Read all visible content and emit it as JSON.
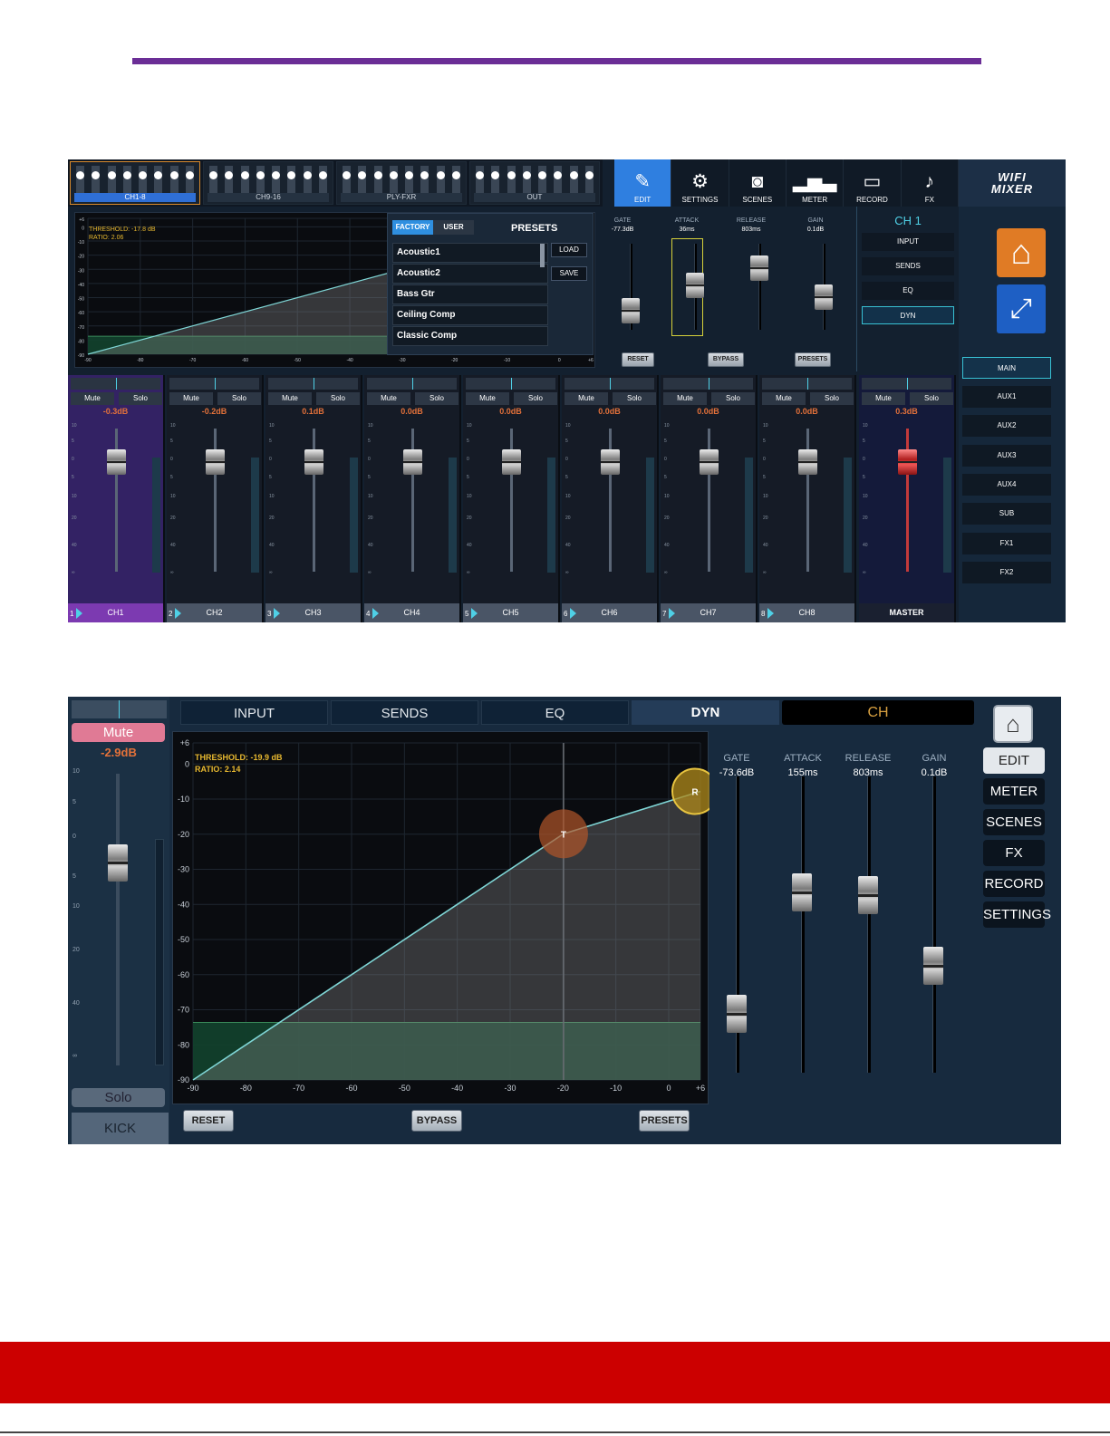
{
  "screen1": {
    "banks": [
      {
        "label": "CH1-8"
      },
      {
        "label": "CH9-16"
      },
      {
        "label": "PLY-FXR"
      },
      {
        "label": "OUT"
      }
    ],
    "top_icons": [
      {
        "label": "EDIT",
        "icon": "edit-icon"
      },
      {
        "label": "SETTINGS",
        "icon": "gear-icon"
      },
      {
        "label": "SCENES",
        "icon": "camera-icon"
      },
      {
        "label": "METER",
        "icon": "bar-chart-icon"
      },
      {
        "label": "RECORD",
        "icon": "cassette-icon"
      },
      {
        "label": "FX",
        "icon": "guitar-icon"
      }
    ],
    "logo": {
      "line1": "WIFI",
      "line2": "MIXER"
    },
    "graph": {
      "threshold": "THRESHOLD: -17.8 dB",
      "ratio": "RATIO: 2.06",
      "y_ticks": [
        "+6",
        "0",
        "-10",
        "-20",
        "-30",
        "-40",
        "-50",
        "-60",
        "-70",
        "-80",
        "-90"
      ],
      "x_ticks": [
        "-90",
        "-80",
        "-70",
        "-60",
        "-50",
        "-40",
        "-30",
        "-20",
        "-10",
        "0",
        "+6"
      ]
    },
    "presets": {
      "tab_factory": "FACTORY",
      "tab_user": "USER",
      "title": "PRESETS",
      "items": [
        "Acoustic1",
        "Acoustic2",
        "Bass Gtr",
        "Ceiling Comp",
        "Classic Comp"
      ],
      "load": "LOAD",
      "save": "SAVE"
    },
    "dyn": [
      {
        "label": "GATE",
        "value": "-77.3dB",
        "level": 0.22
      },
      {
        "label": "ATTACK",
        "value": "36ms",
        "level": 0.52
      },
      {
        "label": "RELEASE",
        "value": "803ms",
        "level": 0.72
      },
      {
        "label": "GAIN",
        "value": "0.1dB",
        "level": 0.38
      }
    ],
    "dyn_buttons": {
      "reset": "RESET",
      "bypass": "BYPASS",
      "presets": "PRESETS"
    },
    "channel_panel": {
      "title": "CH 1",
      "items": [
        "INPUT",
        "SENDS",
        "EQ",
        "DYN"
      ],
      "selected": "DYN"
    },
    "buses": [
      "MAIN",
      "AUX1",
      "AUX2",
      "AUX3",
      "AUX4",
      "SUB",
      "FX1",
      "FX2"
    ],
    "selected_bus": "MAIN",
    "strips": [
      {
        "num": "1",
        "name": "CH1",
        "db": "-0.3dB"
      },
      {
        "num": "2",
        "name": "CH2",
        "db": "-0.2dB"
      },
      {
        "num": "3",
        "name": "CH3",
        "db": "0.1dB"
      },
      {
        "num": "4",
        "name": "CH4",
        "db": "0.0dB"
      },
      {
        "num": "5",
        "name": "CH5",
        "db": "0.0dB"
      },
      {
        "num": "6",
        "name": "CH6",
        "db": "0.0dB"
      },
      {
        "num": "7",
        "name": "CH7",
        "db": "0.0dB"
      },
      {
        "num": "8",
        "name": "CH8",
        "db": "0.0dB"
      }
    ],
    "master": {
      "name": "MASTER",
      "db": "0.3dB"
    },
    "mute_label": "Mute",
    "solo_label": "Solo",
    "fader_scale": [
      "10",
      "5",
      "0",
      "5",
      "10",
      "20",
      "40",
      "∞"
    ]
  },
  "screen2": {
    "left_strip": {
      "mute": "Mute",
      "db": "-2.9dB",
      "solo": "Solo",
      "name": "KICK",
      "scale": [
        "10",
        "5",
        "0",
        "5",
        "10",
        "20",
        "40",
        "∞"
      ]
    },
    "tabs": [
      "INPUT",
      "SENDS",
      "EQ",
      "DYN"
    ],
    "selected_tab": "DYN",
    "channel": "CH",
    "graph": {
      "threshold": "THRESHOLD: -19.9 dB",
      "ratio": "RATIO: 2.14",
      "y_ticks": [
        "+6",
        "0",
        "-10",
        "-20",
        "-30",
        "-40",
        "-50",
        "-60",
        "-70",
        "-80",
        "-90"
      ],
      "x_ticks": [
        "-90",
        "-80",
        "-70",
        "-60",
        "-50",
        "-40",
        "-30",
        "-20",
        "-10",
        "0",
        "+6"
      ],
      "threshold_marker": "T",
      "ratio_marker": "R"
    },
    "buttons": {
      "reset": "RESET",
      "bypass": "BYPASS",
      "presets": "PRESETS"
    },
    "dyn": [
      {
        "label": "GATE",
        "value": "-73.6dB",
        "level": 0.2
      },
      {
        "label": "ATTACK",
        "value": "155ms",
        "level": 0.61
      },
      {
        "label": "RELEASE",
        "value": "803ms",
        "level": 0.6
      },
      {
        "label": "GAIN",
        "value": "0.1dB",
        "level": 0.36
      }
    ],
    "menu": [
      "EDIT",
      "METER",
      "SCENES",
      "FX",
      "RECORD",
      "SETTINGS"
    ],
    "selected_menu": "EDIT"
  },
  "colors": {
    "accent_purple": "#6b2e96",
    "footer_red": "#cc0000",
    "dyn_curve": "#7fd6d6",
    "threshold_text": "#e8b930"
  }
}
